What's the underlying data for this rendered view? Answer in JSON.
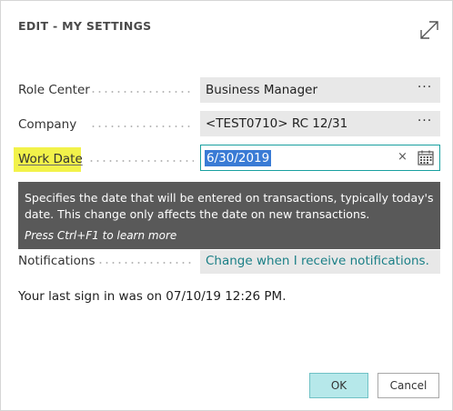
{
  "dialog": {
    "title": "EDIT - MY SETTINGS",
    "expand_icon": "expand-diagonal-icon"
  },
  "fields": {
    "role_center": {
      "label": "Role Center",
      "value": "Business Manager",
      "more": "···"
    },
    "company": {
      "label": "Company",
      "value": "<TEST0710> RC 12/31",
      "more": "···"
    },
    "work_date": {
      "label": "Work Date",
      "value": "6/30/2019",
      "clear": "×",
      "calendar_icon": "calendar-icon"
    },
    "notifications": {
      "label": "Notifications",
      "link": "Change when I receive notifications."
    }
  },
  "tooltip": {
    "description": "Specifies the date that will be entered on transactions, typically today's date. This change only affects the date on new transactions.",
    "hint": "Press Ctrl+F1 to learn more"
  },
  "last_sign_in": "Your last sign in was on 07/10/19 12:26 PM.",
  "buttons": {
    "ok": "OK",
    "cancel": "Cancel"
  },
  "colors": {
    "accent": "#19a0a0",
    "highlight": "#f2f24a",
    "tooltip_bg": "#595959",
    "ok_bg": "#b6e8ea",
    "link": "#1a7f86"
  }
}
